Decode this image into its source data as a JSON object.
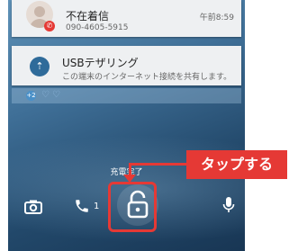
{
  "notifications": {
    "missed_call": {
      "title": "不在着信",
      "number": "090-4605-5915",
      "time": "午前8:59"
    },
    "usb": {
      "title": "USBテザリング",
      "detail": "この端末のインターネット接続を共有します。"
    },
    "strip": {
      "count_badge": "+2"
    }
  },
  "lockscreen": {
    "charge_status": "充電完了",
    "call_count": "1"
  },
  "annotation": {
    "callout_label": "タップする",
    "color": "#e53935"
  },
  "icons": {
    "camera": "camera-icon",
    "phone": "phone-icon",
    "lock": "unlock-icon",
    "mic": "microphone-icon"
  }
}
